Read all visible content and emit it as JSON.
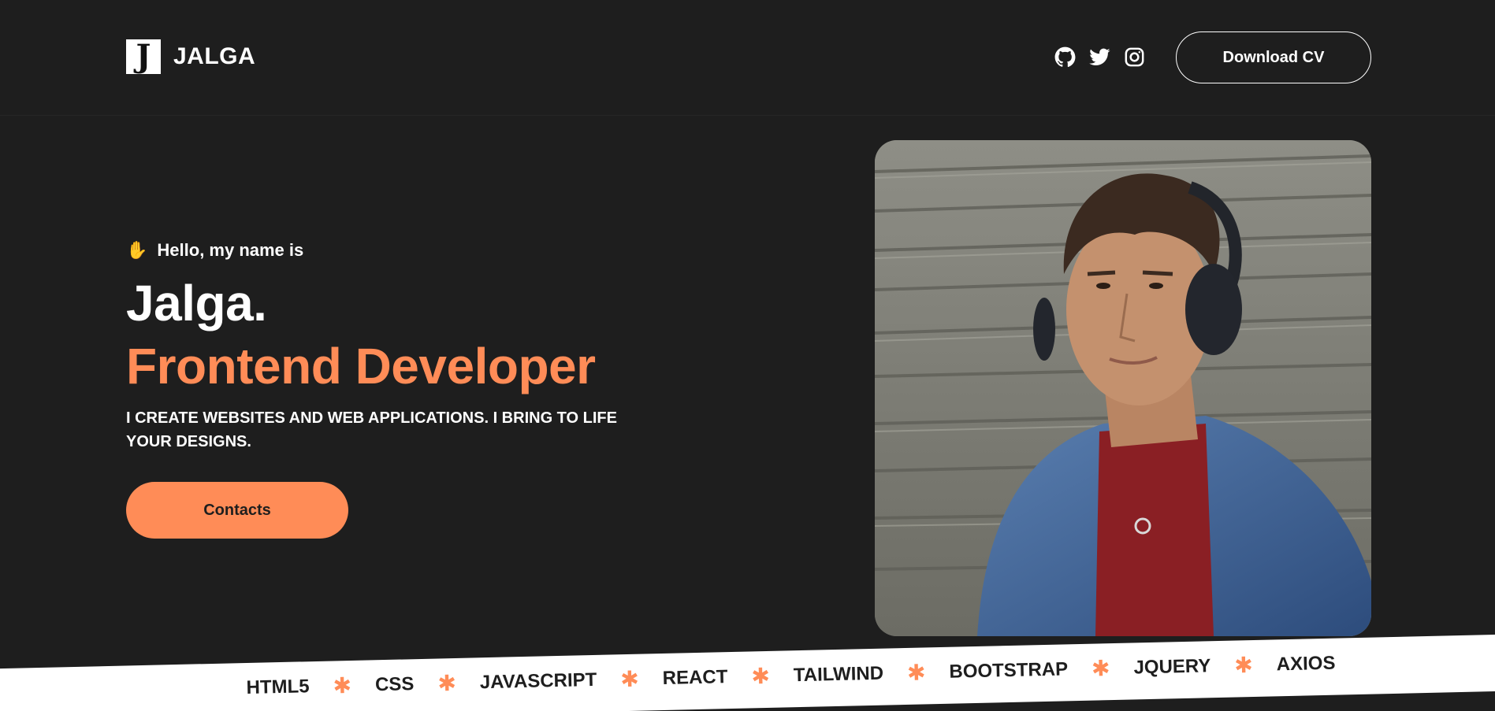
{
  "header": {
    "logo_mark": "J",
    "logo_text": "JALGA",
    "socials": [
      {
        "icon": "github-icon"
      },
      {
        "icon": "twitter-icon"
      },
      {
        "icon": "instagram-icon"
      }
    ],
    "cv_button": "Download CV"
  },
  "hero": {
    "greeting_icon": "✋",
    "greeting": "Hello, my name is",
    "name": "Jalga.",
    "role": "Frontend Developer",
    "tagline": "I CREATE WEBSITES AND WEB APPLICATIONS. I BRING TO LIFE YOUR DESIGNS.",
    "contacts_button": "Contacts"
  },
  "ticker": {
    "items": [
      "HTML5",
      "CSS",
      "JAVASCRIPT",
      "REACT",
      "TAILWIND",
      "BOOTSTRAP",
      "JQUERY",
      "AXIOS"
    ],
    "separator": "✱"
  },
  "colors": {
    "background": "#1e1e1e",
    "accent": "#ff8c57",
    "text": "#ffffff"
  }
}
